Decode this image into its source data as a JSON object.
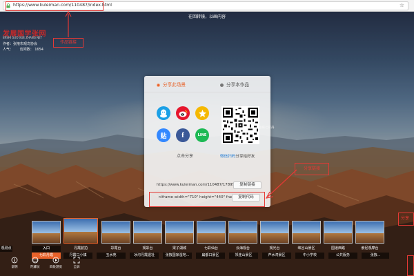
{
  "browser": {
    "url": "https://www.kuleiman.com/110487/index.html"
  },
  "scene": {
    "title": "在回转镜，以画内容"
  },
  "brand": {
    "logo_text": "发展国学张网",
    "logo_sub": "ERSHI GUO XUE ZHANG NET",
    "author": "作者：张掖市观鸟协会",
    "views_label": "人气：",
    "views_label2": "访问数：",
    "views_value": "1654"
  },
  "right_hint": "张掖七彩丹",
  "share_dialog": {
    "tab_active": "分享此场景",
    "tab_inactive": "分享本作品",
    "share_label": "点击分享",
    "scan_prefix": "微信扫码",
    "scan_suffix": "分享给好友",
    "link_text": "https://www.kuleiman.com/110487/17895",
    "copy_link": "复制链接",
    "embed_text": "<iframe width=\"710\" height=\"440\" frameb",
    "copy_code": "复制代码",
    "icons": {
      "qq": "qq-icon",
      "weibo": "weibo-icon",
      "qzone": "qzone-icon",
      "tieba": "tieba-icon",
      "tieba_glyph": "贴",
      "facebook": "facebook-icon",
      "facebook_glyph": "f",
      "line": "line-icon",
      "line_glyph": "LINE"
    }
  },
  "annotations": {
    "url_note": "作品链接",
    "code_note": "分享链接",
    "right_note": "分享"
  },
  "thumbnails": {
    "first_partial_label": "观测点",
    "items": [
      {
        "label": "入口"
      },
      {
        "label": "七彩丹霞"
      },
      {
        "label": "丹霞口小镇"
      },
      {
        "label": "玉水苑"
      },
      {
        "label": "冰沟丹霞遗址"
      },
      {
        "label": "张掖国家湿地..."
      },
      {
        "label": "扁都口景区"
      },
      {
        "label": "祁连山景区"
      },
      {
        "label": "芦水湾景区"
      },
      {
        "label": "中小学校"
      },
      {
        "label": "公共服务"
      },
      {
        "label": "张掖..."
      }
    ],
    "strip_titles": [
      "入口",
      "丹霞航拍",
      "彩霞台",
      "观彩台",
      "梁子湖城",
      "七彩仙台",
      "云海观台",
      "观光台",
      "峡谷山景区",
      "国道西路",
      "索尼观摩台"
    ]
  },
  "toolbar": {
    "items": [
      {
        "label": "说明",
        "icon": "info-icon"
      },
      {
        "label": "陀螺仪",
        "icon": "gyroscope-icon"
      },
      {
        "label": "四处游览",
        "icon": "tour-icon"
      },
      {
        "label": "全屏",
        "icon": "fullscreen-icon"
      }
    ]
  },
  "colors": {
    "accent": "#e8622a",
    "annotation_red": "#e53935",
    "link_blue": "#2a7fd4"
  }
}
